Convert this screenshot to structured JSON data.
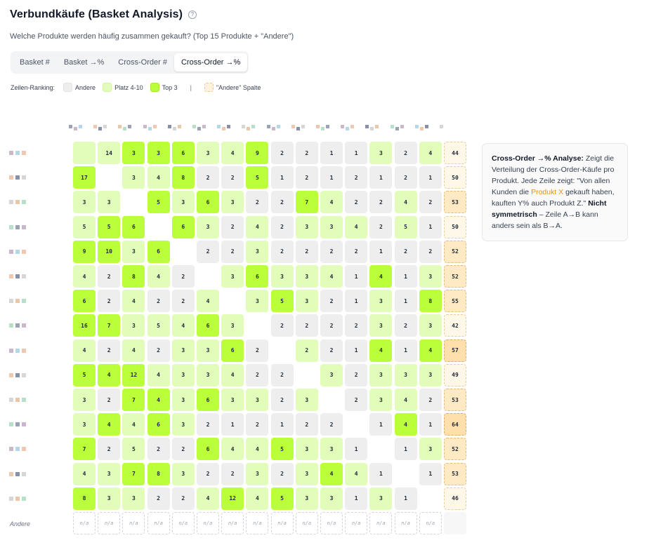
{
  "header": {
    "title": "Verbundkäufe (Basket Analysis)",
    "help_icon": "question-circle-icon",
    "subtitle": "Welche Produkte werden häufig zusammen gekauft? (Top 15 Produkte + \"Andere\")"
  },
  "tabs": [
    {
      "label": "Basket #",
      "active": false
    },
    {
      "label": "Basket →%",
      "active": false
    },
    {
      "label": "Cross-Order #",
      "active": false
    },
    {
      "label": "Cross-Order →%",
      "active": true
    }
  ],
  "legend": {
    "label": "Zeilen-Ranking:",
    "items": [
      "Andere",
      "Platz 4-10",
      "Top 3"
    ],
    "separator": "|",
    "column_item": "\"Andere\" Spalte"
  },
  "colors": {
    "andere": "#eeeeee",
    "platz": "#e2fcb9",
    "top": "#bbff3a",
    "andere_column": "#ffe0ad",
    "highlight": "#e8910c"
  },
  "matrix": {
    "values": [
      [
        null,
        14,
        3,
        3,
        6,
        3,
        4,
        9,
        2,
        2,
        1,
        1,
        3,
        2,
        4,
        44
      ],
      [
        17,
        null,
        3,
        4,
        8,
        2,
        2,
        5,
        1,
        2,
        1,
        2,
        1,
        2,
        1,
        50
      ],
      [
        3,
        3,
        null,
        5,
        3,
        6,
        3,
        2,
        2,
        7,
        4,
        2,
        2,
        4,
        2,
        53
      ],
      [
        5,
        5,
        6,
        null,
        6,
        3,
        2,
        4,
        2,
        3,
        3,
        4,
        2,
        5,
        1,
        50
      ],
      [
        9,
        10,
        3,
        6,
        null,
        2,
        2,
        3,
        2,
        2,
        2,
        2,
        1,
        2,
        2,
        52
      ],
      [
        4,
        2,
        8,
        4,
        2,
        null,
        3,
        6,
        3,
        3,
        4,
        1,
        4,
        1,
        3,
        52
      ],
      [
        6,
        2,
        4,
        2,
        2,
        4,
        null,
        3,
        5,
        3,
        2,
        1,
        3,
        1,
        8,
        55
      ],
      [
        16,
        7,
        3,
        5,
        4,
        6,
        3,
        null,
        2,
        2,
        2,
        2,
        3,
        2,
        3,
        42
      ],
      [
        4,
        2,
        4,
        2,
        3,
        3,
        6,
        2,
        null,
        2,
        2,
        1,
        4,
        1,
        4,
        57
      ],
      [
        5,
        4,
        12,
        4,
        3,
        3,
        4,
        2,
        2,
        null,
        3,
        2,
        3,
        3,
        3,
        49
      ],
      [
        3,
        2,
        7,
        4,
        3,
        6,
        3,
        3,
        2,
        3,
        null,
        2,
        3,
        4,
        2,
        53
      ],
      [
        3,
        4,
        4,
        6,
        3,
        2,
        1,
        2,
        1,
        2,
        2,
        null,
        1,
        4,
        1,
        64
      ],
      [
        7,
        2,
        5,
        2,
        2,
        6,
        4,
        4,
        5,
        3,
        3,
        1,
        null,
        1,
        3,
        52
      ],
      [
        4,
        3,
        7,
        8,
        3,
        2,
        2,
        3,
        2,
        3,
        4,
        4,
        1,
        null,
        1,
        53
      ],
      [
        8,
        3,
        3,
        2,
        2,
        4,
        12,
        4,
        5,
        3,
        3,
        1,
        3,
        1,
        null,
        46
      ]
    ],
    "categories": [
      [
        "p",
        "p",
        "t",
        "t",
        "t",
        "p",
        "p",
        "t",
        "a",
        "a",
        "a",
        "a",
        "p",
        "a",
        "p"
      ],
      [
        "t",
        "d",
        "p",
        "p",
        "t",
        "a",
        "a",
        "t",
        "a",
        "a",
        "a",
        "a",
        "a",
        "a",
        "a"
      ],
      [
        "p",
        "p",
        "d",
        "t",
        "p",
        "t",
        "p",
        "a",
        "a",
        "t",
        "p",
        "a",
        "a",
        "p",
        "a"
      ],
      [
        "p",
        "t",
        "t",
        "d",
        "t",
        "p",
        "a",
        "p",
        "a",
        "p",
        "p",
        "p",
        "a",
        "p",
        "a"
      ],
      [
        "t",
        "t",
        "p",
        "t",
        "d",
        "a",
        "a",
        "p",
        "a",
        "a",
        "a",
        "a",
        "a",
        "a",
        "a"
      ],
      [
        "p",
        "a",
        "t",
        "p",
        "a",
        "d",
        "p",
        "t",
        "p",
        "p",
        "p",
        "a",
        "t",
        "a",
        "p"
      ],
      [
        "t",
        "a",
        "p",
        "a",
        "a",
        "p",
        "d",
        "p",
        "t",
        "p",
        "a",
        "a",
        "p",
        "a",
        "t"
      ],
      [
        "t",
        "t",
        "p",
        "p",
        "p",
        "t",
        "p",
        "d",
        "a",
        "a",
        "a",
        "a",
        "p",
        "a",
        "p"
      ],
      [
        "p",
        "a",
        "p",
        "a",
        "p",
        "p",
        "t",
        "a",
        "d",
        "p",
        "a",
        "a",
        "t",
        "a",
        "t"
      ],
      [
        "t",
        "t",
        "t",
        "p",
        "p",
        "p",
        "p",
        "a",
        "a",
        "d",
        "p",
        "a",
        "p",
        "p",
        "p"
      ],
      [
        "p",
        "a",
        "t",
        "t",
        "p",
        "t",
        "p",
        "p",
        "a",
        "p",
        "d",
        "a",
        "p",
        "p",
        "a"
      ],
      [
        "p",
        "t",
        "p",
        "t",
        "p",
        "a",
        "a",
        "a",
        "a",
        "a",
        "a",
        "d",
        "a",
        "t",
        "a"
      ],
      [
        "t",
        "a",
        "p",
        "a",
        "a",
        "t",
        "p",
        "p",
        "t",
        "p",
        "p",
        "a",
        "d",
        "a",
        "p"
      ],
      [
        "p",
        "p",
        "t",
        "t",
        "p",
        "a",
        "a",
        "p",
        "a",
        "p",
        "t",
        "p",
        "a",
        "d",
        "a"
      ],
      [
        "t",
        "p",
        "p",
        "a",
        "a",
        "p",
        "t",
        "p",
        "t",
        "p",
        "p",
        "a",
        "p",
        "a",
        "d"
      ]
    ],
    "andere_column_shade": [
      1,
      1,
      2,
      1,
      2,
      2,
      2,
      1,
      3,
      1,
      2,
      3,
      2,
      2,
      1
    ],
    "andere_row_label": "Andere",
    "na_label": "n/a"
  },
  "info": {
    "heading": "Cross-Order →% Analyse:",
    "text1": " Zeigt die Verteilung der Cross-Order-Käufe pro Produkt. Jede Zeile zeigt: \"Von allen Kunden die ",
    "highlight": "Produkt X",
    "text2": " gekauft haben, kauften Y% auch Produkt Z.\" ",
    "bold2": "Nicht symmetrisch",
    "text3": " – Zeile A→B kann anders sein als B→A."
  }
}
